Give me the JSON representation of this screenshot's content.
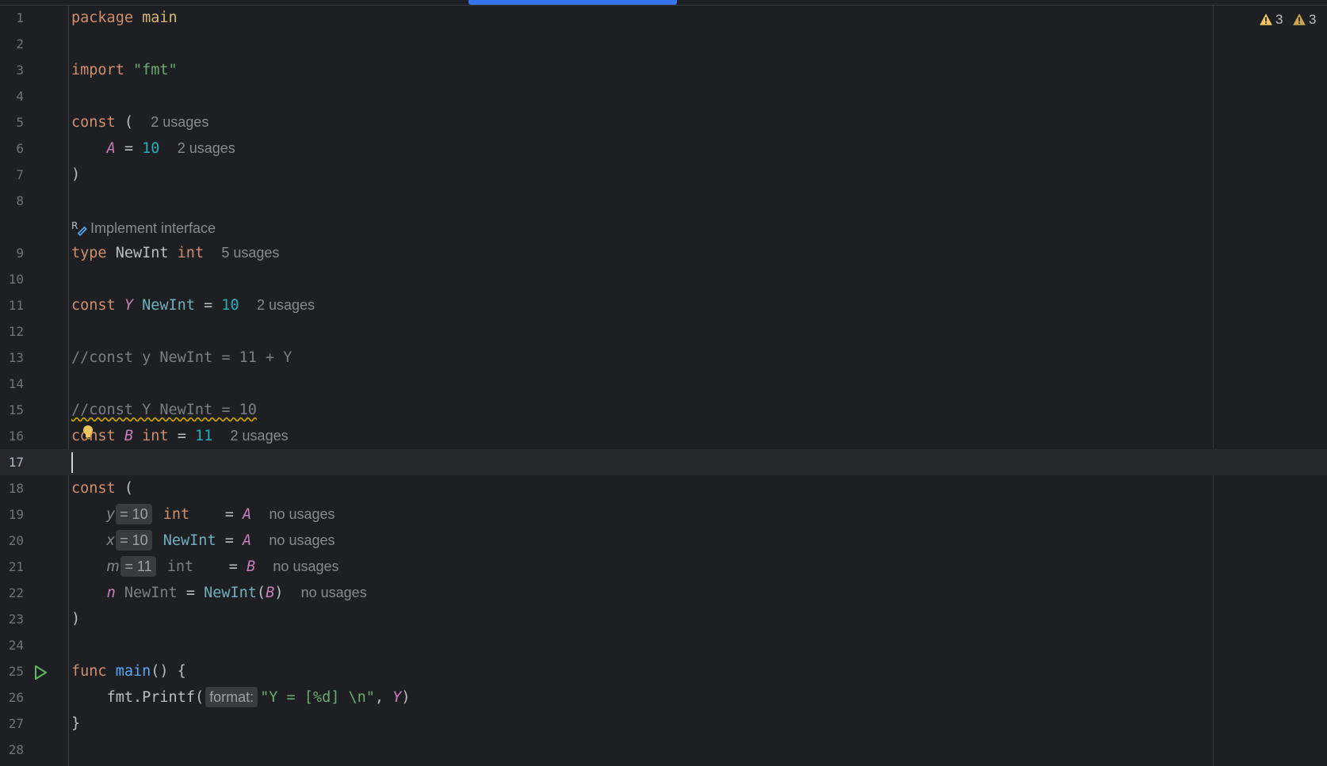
{
  "scrollbar": {},
  "inspections": [
    {
      "icon": "warning-icon",
      "count": "3"
    },
    {
      "icon": "warning-icon",
      "count": "3"
    }
  ],
  "hints": {
    "usages2": "2 usages",
    "usages5": "5 usages",
    "no_usages": "no usages",
    "implement_interface": "Implement interface",
    "format_param": "format:"
  },
  "line_numbers": [
    "1",
    "2",
    "3",
    "4",
    "5",
    "6",
    "7",
    "8",
    "9",
    "10",
    "11",
    "12",
    "13",
    "14",
    "15",
    "16",
    "17",
    "18",
    "19",
    "20",
    "21",
    "22",
    "23",
    "24",
    "25",
    "26",
    "27",
    "28"
  ],
  "code": {
    "l1": {
      "kw": "package",
      "name": "main"
    },
    "l3": {
      "kw": "import",
      "str": "\"fmt\""
    },
    "l5": {
      "kw": "const",
      "paren": "("
    },
    "l6": {
      "name": "A",
      "eq": "=",
      "val": "10"
    },
    "l7": {
      "paren": ")"
    },
    "l9": {
      "kw": "type",
      "name": "NewInt",
      "type": "int"
    },
    "l11": {
      "kw": "const",
      "name": "Y",
      "type": "NewInt",
      "eq": "=",
      "val": "10"
    },
    "l13": {
      "comment": "//const y NewInt = 11 + Y"
    },
    "l15": {
      "comment": "//const Y NewInt = 10"
    },
    "l16": {
      "kw": "const",
      "name": "B",
      "type": "int",
      "eq": "=",
      "val": "11"
    },
    "l18": {
      "kw": "const",
      "paren": "("
    },
    "l19": {
      "name": "y",
      "inlay": "= 10",
      "type": "int",
      "eq": "=",
      "ref": "A"
    },
    "l20": {
      "name": "x",
      "inlay": "= 10",
      "type": "NewInt",
      "eq": "=",
      "ref": "A"
    },
    "l21": {
      "name": "m",
      "inlay": "= 11",
      "type": "int",
      "eq": "=",
      "ref": "B"
    },
    "l22": {
      "name": "n",
      "type": "NewInt",
      "eq": "=",
      "call": "NewInt",
      "open": "(",
      "arg": "B",
      "close": ")"
    },
    "l23": {
      "paren": ")"
    },
    "l25": {
      "kw": "func",
      "name": "main",
      "rest": "() {"
    },
    "l26": {
      "obj": "fmt",
      "dot": ".",
      "method": "Printf",
      "open": "(",
      "str": "\"Y = [%d] \\n\"",
      "comma": ",",
      "arg": "Y",
      "close": ")"
    },
    "l27": {
      "brace": "}"
    }
  }
}
